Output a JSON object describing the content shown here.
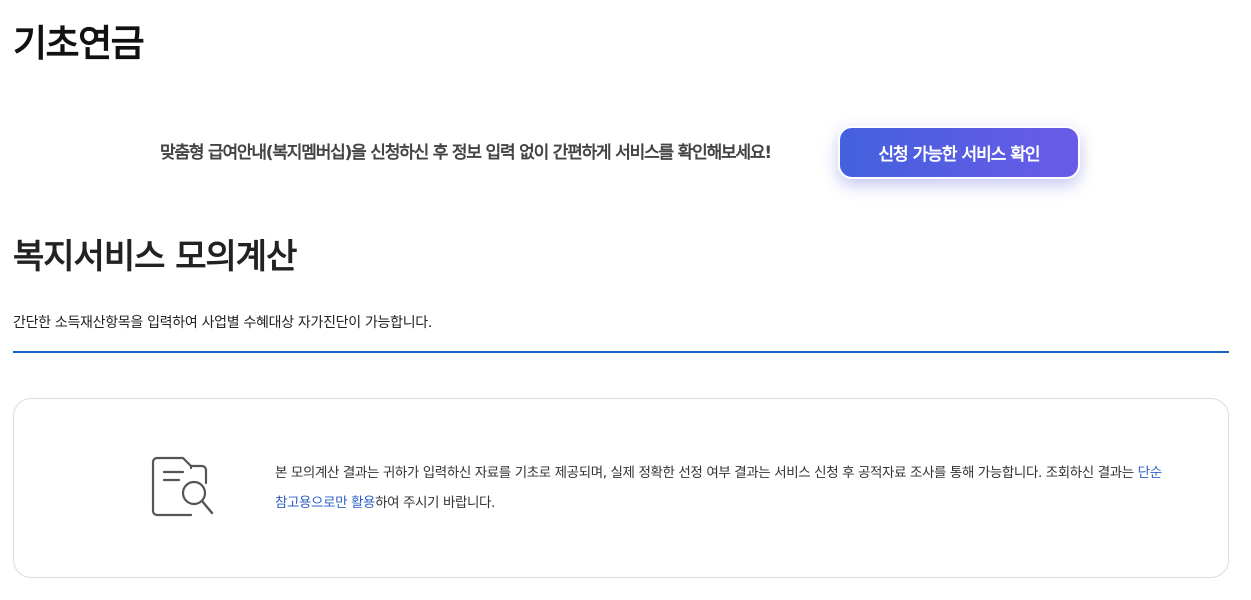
{
  "page": {
    "title": "기초연금"
  },
  "promo": {
    "text": "맞춤형 급여안내(복지멤버십)을 신청하신 후 정보 입력 없이 간편하게 서비스를 확인해보세요!",
    "button_label": "신청 가능한 서비스 확인"
  },
  "calc_section": {
    "title": "복지서비스 모의계산",
    "description": "간단한 소득재산항목을 입력하여 사업별 수혜대상 자가진단이 가능합니다."
  },
  "notice": {
    "icon": "document-search-icon",
    "text_part1": "본 모의계산 결과는 귀하가 입력하신 자료를 기초로 제공되며, 실제 정확한 선정 여부 결과는 서비스 신청 후 공적자료 조사를 통해 가능합니다. 조회하신 결과는 ",
    "text_highlight": "단순 참고용으로만 활용",
    "text_part2": "하여 주시기 바랍니다."
  },
  "colors": {
    "accent_blue": "#1565c0",
    "highlight_blue": "#2d5fc4",
    "button_gradient_start": "#4361dd",
    "button_gradient_end": "#6a5ae8"
  }
}
